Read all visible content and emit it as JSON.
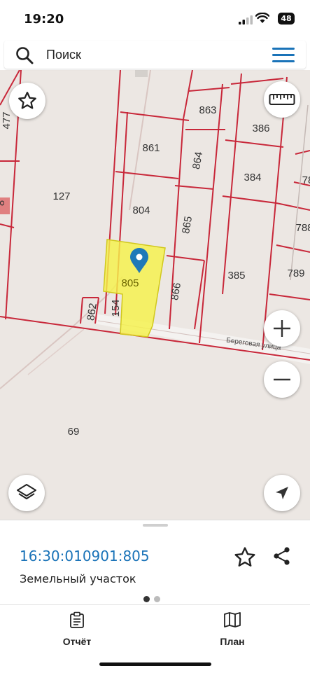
{
  "status_bar": {
    "time": "19:20",
    "battery": "48"
  },
  "search": {
    "placeholder": "Поиск"
  },
  "map": {
    "parcels": [
      "477",
      "127",
      "861",
      "863",
      "386",
      "864",
      "384",
      "804",
      "865",
      "805",
      "866",
      "385",
      "789",
      "862",
      "154",
      "69",
      "78",
      "788",
      "8"
    ],
    "street": "Береговая улица"
  },
  "selected": {
    "cadastral_number": "16:30:010901:805",
    "type": "Земельный участок"
  },
  "tabs": [
    {
      "label": "Отчёт"
    },
    {
      "label": "План"
    }
  ],
  "colors": {
    "accent": "#1a73b8",
    "parcel_line": "#c8283a",
    "highlight": "#f5f24a"
  }
}
